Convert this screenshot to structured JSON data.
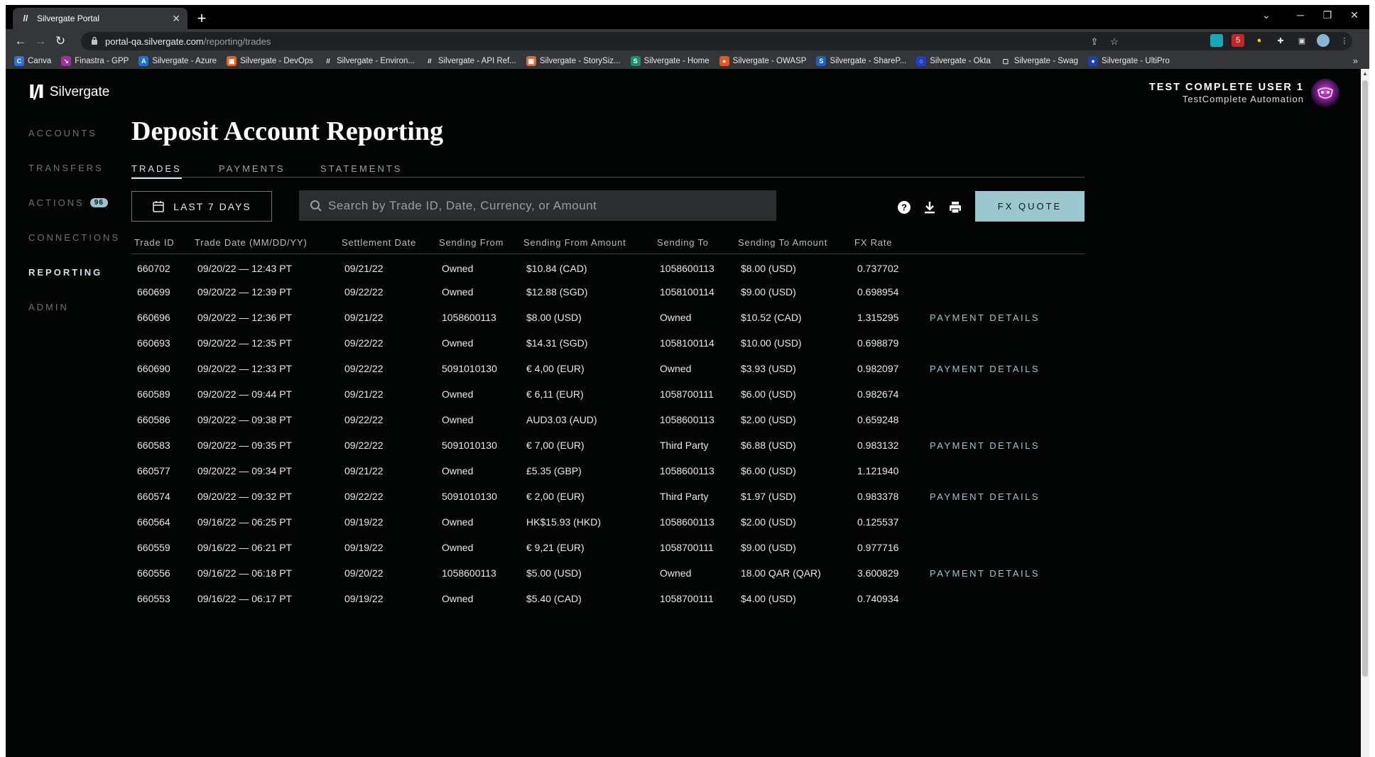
{
  "browser": {
    "tab_title": "Silvergate Portal",
    "url_host": "portal-qa.silvergate.com",
    "url_path": "/reporting/trades",
    "bookmarks": [
      {
        "label": "Canva",
        "color": "#2f6fe0",
        "icon": "C"
      },
      {
        "label": "Finastra - GPP",
        "color": "#a030a0",
        "icon": "↘"
      },
      {
        "label": "Silvergate - Azure",
        "color": "#1e6fd6",
        "icon": "A"
      },
      {
        "label": "Silvergate - DevOps",
        "color": "#e86420",
        "icon": "▦"
      },
      {
        "label": "Silvergate - Environ...",
        "color": "#35363a",
        "icon": "//"
      },
      {
        "label": "Silvergate - API Ref...",
        "color": "#35363a",
        "icon": "//"
      },
      {
        "label": "Silvergate - StorySiz...",
        "color": "#d07040",
        "icon": "▣"
      },
      {
        "label": "Silvergate - Home",
        "color": "#1f8e6e",
        "icon": "S"
      },
      {
        "label": "Silvergate - OWASP",
        "color": "#e05a20",
        "icon": "●"
      },
      {
        "label": "Silvergate - ShareP...",
        "color": "#1e5fc6",
        "icon": "S"
      },
      {
        "label": "Silvergate - Okta",
        "color": "#1e3fc6",
        "icon": "○"
      },
      {
        "label": "Silvergate - Swag",
        "color": "#35363a",
        "icon": "▢"
      },
      {
        "label": "Silvergate - UltiPro",
        "color": "#2040b0",
        "icon": "●"
      }
    ]
  },
  "app": {
    "logo_text": "Silvergate",
    "nav": [
      {
        "label": "ACCOUNTS",
        "active": false
      },
      {
        "label": "TRANSFERS",
        "active": false
      },
      {
        "label": "ACTIONS",
        "active": false,
        "badge": "96"
      },
      {
        "label": "CONNECTIONS",
        "active": false
      },
      {
        "label": "REPORTING",
        "active": true
      },
      {
        "label": "ADMIN",
        "active": false
      }
    ],
    "user": {
      "name": "TEST COMPLETE USER 1",
      "org": "TestComplete Automation"
    },
    "page_title": "Deposit Account Reporting",
    "tabs": [
      {
        "label": "TRADES",
        "active": true
      },
      {
        "label": "PAYMENTS",
        "active": false
      },
      {
        "label": "STATEMENTS",
        "active": false
      }
    ],
    "date_filter": "LAST 7 DAYS",
    "search_placeholder": "Search by Trade ID, Date, Currency, or Amount",
    "fx_quote": "FX QUOTE",
    "payment_details": "PAYMENT DETAILS",
    "columns": [
      "Trade ID",
      "Trade Date (MM/DD/YY)",
      "Settlement Date",
      "Sending From",
      "Sending From Amount",
      "Sending To",
      "Sending To Amount",
      "FX Rate"
    ],
    "rows": [
      {
        "id": "660702",
        "date": "09/20/22 — 12:43 PT",
        "settle": "09/21/22",
        "from": "Owned",
        "from_amt": "$10.84 (CAD)",
        "to": "1058600113",
        "to_amt": "$8.00 (USD)",
        "rate": "0.737702",
        "details": false
      },
      {
        "id": "660699",
        "date": "09/20/22 — 12:39 PT",
        "settle": "09/22/22",
        "from": "Owned",
        "from_amt": "$12.88 (SGD)",
        "to": "1058100114",
        "to_amt": "$9.00 (USD)",
        "rate": "0.698954",
        "details": false
      },
      {
        "id": "660696",
        "date": "09/20/22 — 12:36 PT",
        "settle": "09/21/22",
        "from": "1058600113",
        "from_amt": "$8.00 (USD)",
        "to": "Owned",
        "to_amt": "$10.52 (CAD)",
        "rate": "1.315295",
        "details": true
      },
      {
        "id": "660693",
        "date": "09/20/22 — 12:35 PT",
        "settle": "09/22/22",
        "from": "Owned",
        "from_amt": "$14.31 (SGD)",
        "to": "1058100114",
        "to_amt": "$10.00 (USD)",
        "rate": "0.698879",
        "details": false
      },
      {
        "id": "660690",
        "date": "09/20/22 — 12:33 PT",
        "settle": "09/22/22",
        "from": "5091010130",
        "from_amt": "€ 4,00 (EUR)",
        "to": "Owned",
        "to_amt": "$3.93 (USD)",
        "rate": "0.982097",
        "details": true
      },
      {
        "id": "660589",
        "date": "09/20/22 — 09:44 PT",
        "settle": "09/21/22",
        "from": "Owned",
        "from_amt": "€ 6,11 (EUR)",
        "to": "1058700111",
        "to_amt": "$6.00 (USD)",
        "rate": "0.982674",
        "details": false
      },
      {
        "id": "660586",
        "date": "09/20/22 — 09:38 PT",
        "settle": "09/22/22",
        "from": "Owned",
        "from_amt": "AUD3.03 (AUD)",
        "to": "1058600113",
        "to_amt": "$2.00 (USD)",
        "rate": "0.659248",
        "details": false
      },
      {
        "id": "660583",
        "date": "09/20/22 — 09:35 PT",
        "settle": "09/22/22",
        "from": "5091010130",
        "from_amt": "€ 7,00 (EUR)",
        "to": "Third Party",
        "to_amt": "$6.88 (USD)",
        "rate": "0.983132",
        "details": true
      },
      {
        "id": "660577",
        "date": "09/20/22 — 09:34 PT",
        "settle": "09/21/22",
        "from": "Owned",
        "from_amt": "£5.35 (GBP)",
        "to": "1058600113",
        "to_amt": "$6.00 (USD)",
        "rate": "1.121940",
        "details": false
      },
      {
        "id": "660574",
        "date": "09/20/22 — 09:32 PT",
        "settle": "09/22/22",
        "from": "5091010130",
        "from_amt": "€ 2,00 (EUR)",
        "to": "Third Party",
        "to_amt": "$1.97 (USD)",
        "rate": "0.983378",
        "details": true
      },
      {
        "id": "660564",
        "date": "09/16/22 — 06:25 PT",
        "settle": "09/19/22",
        "from": "Owned",
        "from_amt": "HK$15.93 (HKD)",
        "to": "1058600113",
        "to_amt": "$2.00 (USD)",
        "rate": "0.125537",
        "details": false
      },
      {
        "id": "660559",
        "date": "09/16/22 — 06:21 PT",
        "settle": "09/19/22",
        "from": "Owned",
        "from_amt": "€ 9,21 (EUR)",
        "to": "1058700111",
        "to_amt": "$9.00 (USD)",
        "rate": "0.977716",
        "details": false
      },
      {
        "id": "660556",
        "date": "09/16/22 — 06:18 PT",
        "settle": "09/20/22",
        "from": "1058600113",
        "from_amt": "$5.00 (USD)",
        "to": "Owned",
        "to_amt": "18.00 QAR (QAR)",
        "rate": "3.600829",
        "details": true
      },
      {
        "id": "660553",
        "date": "09/16/22 — 06:17 PT",
        "settle": "09/19/22",
        "from": "Owned",
        "from_amt": "$5.40 (CAD)",
        "to": "1058700111",
        "to_amt": "$4.00 (USD)",
        "rate": "0.740934",
        "details": false
      }
    ]
  },
  "colors": {
    "accent": "#9bc7cf",
    "background": "#030404",
    "muted_nav": "#6d7277"
  }
}
